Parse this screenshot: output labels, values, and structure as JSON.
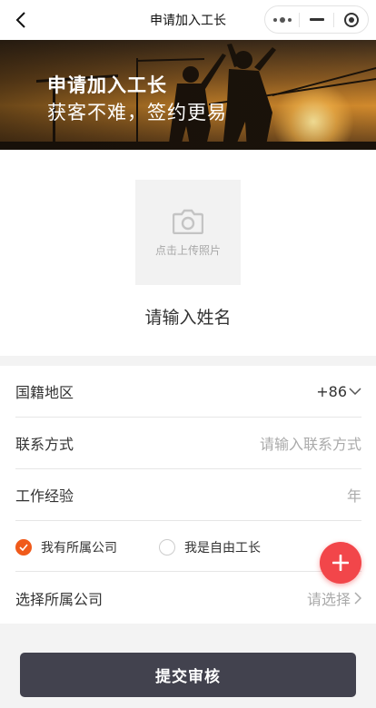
{
  "navbar": {
    "title": "申请加入工长",
    "back_icon": "chevron-left-icon",
    "capsule": {
      "more_icon": "more-dots-icon",
      "minimize_icon": "minus-icon",
      "close_icon": "target-icon"
    }
  },
  "banner": {
    "title": "申请加入工长",
    "subtitle": "获客不难，签约更易"
  },
  "profile": {
    "upload_icon": "camera-icon",
    "upload_text": "点击上传照片",
    "name_placeholder": "请输入姓名"
  },
  "form": {
    "nationality": {
      "label": "国籍地区",
      "value": "+86",
      "icon": "chevron-down-icon"
    },
    "contact": {
      "label": "联系方式",
      "placeholder": "请输入联系方式"
    },
    "experience": {
      "label": "工作经验",
      "placeholder": "年"
    },
    "company_type": {
      "options": [
        {
          "label": "我有所属公司",
          "selected": true
        },
        {
          "label": "我是自由工长",
          "selected": false
        }
      ]
    },
    "company": {
      "label": "选择所属公司",
      "placeholder": "请选择",
      "icon": "chevron-right-icon"
    }
  },
  "fab": {
    "icon": "plus-icon"
  },
  "submit": {
    "label": "提交审核"
  },
  "colors": {
    "accent": "#f05a1a",
    "fab": "#f2464a",
    "submit_bg": "#42424e"
  }
}
